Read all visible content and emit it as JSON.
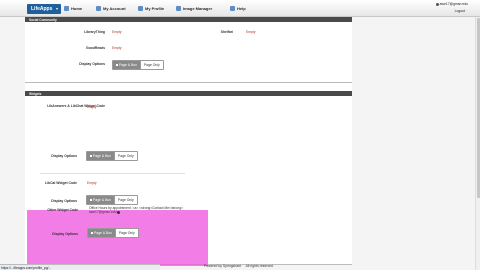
{
  "app": {
    "brand": "LifeApps",
    "nav": [
      {
        "label": "Home"
      },
      {
        "label": "My Account"
      },
      {
        "label": "My Profile"
      },
      {
        "label": "Image Manager"
      },
      {
        "label": "Help"
      }
    ],
    "user_email": "awe17@gmsn.edu",
    "logout_label": "Logout"
  },
  "social_panel": {
    "title": "Social Community",
    "library_thing_label": "LibraryThing",
    "library_thing_value": "Empty",
    "shelfari_label": "Shelfari",
    "shelfari_value": "Empty",
    "goodreads_label": "GoodReads",
    "goodreads_value": "Empty",
    "display_options_label": "Display Options"
  },
  "widgets_panel": {
    "title": "Widgets",
    "libanswers_label": "LibAnswers & LibChat Widget Code",
    "libanswers_value": "Empty",
    "display_options_label": "Display Options",
    "libcal_label": "LibCal Widget Code",
    "libcal_value": "Empty",
    "other_label": "Other Widget Code",
    "other_value": "Office Hours by appointment. <a> <strong>Contact Me</strong> awe17@gmsn.edu",
    "display_options_label_2": "Display Options",
    "display_options_label_3": "Display Options"
  },
  "buttons": {
    "page_box": "Page & Box",
    "page_only": "Page Only"
  },
  "footer": {
    "powered_by": "Powered by Springshare.",
    "rights": "All rights reserved."
  },
  "statusbar": {
    "url": "https://...lifeapps.com/profile_pg/..."
  },
  "colors": {
    "brand": "#1f5f9c",
    "empty_value": "#b03030",
    "highlight": "#ee58e0",
    "panel_header": "#4a4a4a"
  },
  "icons": {
    "brand_caret": "chevron-down-icon",
    "home": "home-icon",
    "account": "account-icon",
    "profile": "profile-icon",
    "image_manager": "image-icon",
    "help": "help-icon",
    "user": "user-icon"
  }
}
